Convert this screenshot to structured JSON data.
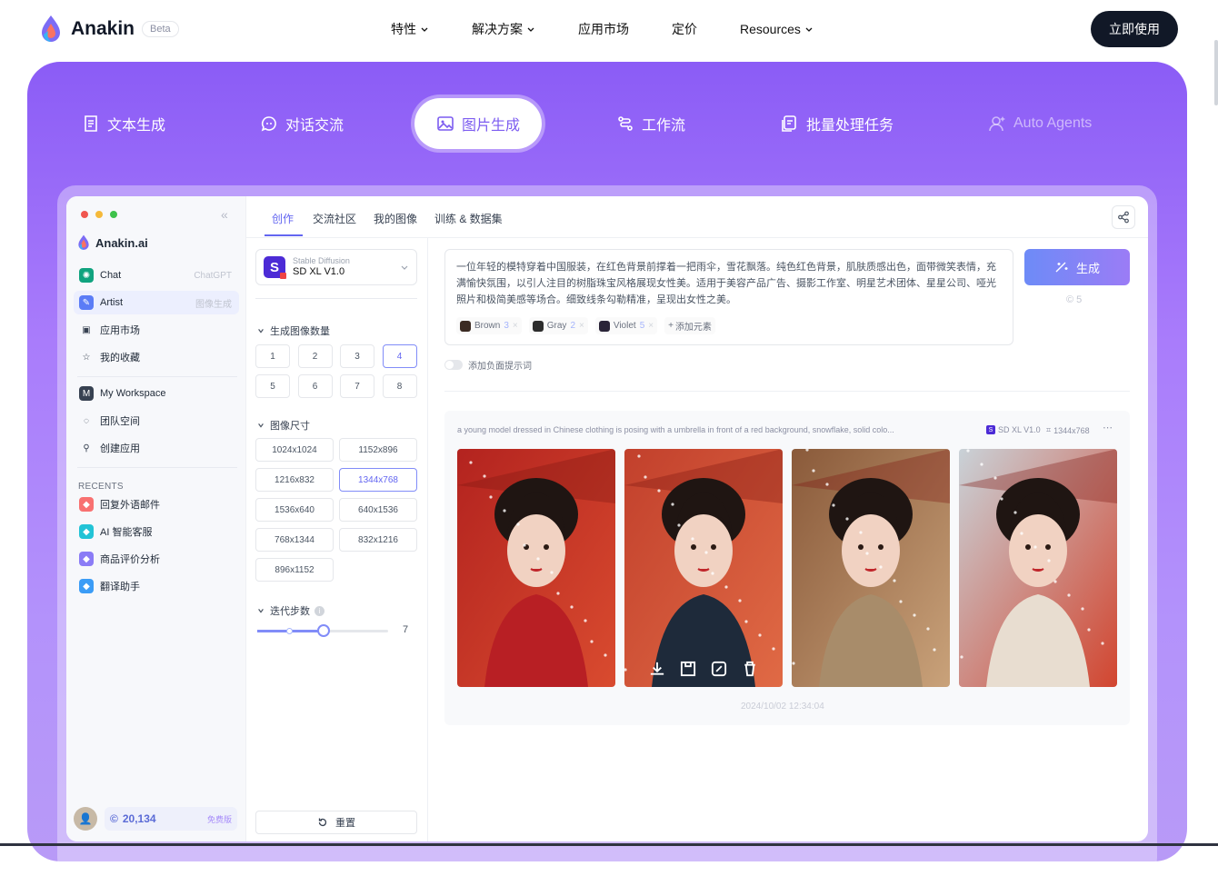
{
  "nav": {
    "logo": "Anakin",
    "beta": "Beta",
    "menu": [
      {
        "label": "特性",
        "dropdown": true
      },
      {
        "label": "解决方案",
        "dropdown": true
      },
      {
        "label": "应用市场",
        "dropdown": false
      },
      {
        "label": "定价",
        "dropdown": false
      },
      {
        "label": "Resources",
        "dropdown": true
      }
    ],
    "cta": "立即使用"
  },
  "feature_tabs": [
    {
      "label": "文本生成",
      "icon": "document-icon"
    },
    {
      "label": "对话交流",
      "icon": "chat-bubble-icon"
    },
    {
      "label": "图片生成",
      "icon": "image-icon",
      "active": true
    },
    {
      "label": "工作流",
      "icon": "workflow-icon"
    },
    {
      "label": "批量处理任务",
      "icon": "batch-icon"
    },
    {
      "label": "Auto Agents",
      "icon": "agent-icon"
    }
  ],
  "app": {
    "brand": "Anakin.ai",
    "sidebar": {
      "items": [
        {
          "label": "Chat",
          "tag": "ChatGPT",
          "icon": "chatgpt-icon"
        },
        {
          "label": "Artist",
          "tag": "图像生成",
          "icon": "artist-icon",
          "selected": true
        },
        {
          "label": "应用市场",
          "tag": "",
          "icon": "store-icon"
        },
        {
          "label": "我的收藏",
          "tag": "",
          "icon": "star-icon"
        }
      ],
      "workspace_items": [
        {
          "label": "My Workspace",
          "icon": "workspace-icon"
        },
        {
          "label": "团队空间",
          "icon": "team-icon"
        },
        {
          "label": "创建应用",
          "icon": "create-app-icon"
        }
      ],
      "recents_title": "RECENTS",
      "recents": [
        {
          "label": "回复外语邮件",
          "color": "#f87171"
        },
        {
          "label": "AI 智能客服",
          "color": "#22c3d6"
        },
        {
          "label": "商品评价分析",
          "color": "#8b7cf6"
        },
        {
          "label": "翻译助手",
          "color": "#3b9cf6"
        }
      ],
      "credits": "20,134",
      "plan": "免费版"
    },
    "top_tabs": [
      "创作",
      "交流社区",
      "我的图像",
      "训练 & 数据集"
    ],
    "model": {
      "provider": "Stable Diffusion",
      "name": "SD XL V1.0"
    },
    "count_title": "生成图像数量",
    "counts": [
      "1",
      "2",
      "3",
      "4",
      "5",
      "6",
      "7",
      "8"
    ],
    "count_selected": "4",
    "size_title": "图像尺寸",
    "sizes": [
      "1024x1024",
      "1152x896",
      "1216x832",
      "1344x768",
      "1536x640",
      "640x1536",
      "768x1344",
      "832x1216",
      "896x1152"
    ],
    "size_selected": "1344x768",
    "steps_title": "迭代步数",
    "steps_value": "7",
    "steps_level_percent": 50,
    "reset": "重置",
    "prompt": "一位年轻的模特穿着中国服装，在红色背景前撑着一把雨伞，雪花飘落。纯色红色背景，肌肤质感出色，面带微笑表情，充满愉快氛围，以引人注目的树脂珠宝风格展现女性美。适用于美容产品广告、摄影工作室、明星艺术团体、星星公司、哑光照片和极简美感等场合。细致线条勾勒精准，呈现出女性之美。",
    "elements": [
      {
        "label": "Brown",
        "num": "3",
        "color": "#3b2a22"
      },
      {
        "label": "Gray",
        "num": "2",
        "color": "#2d2d2d"
      },
      {
        "label": "Violet",
        "num": "5",
        "color": "#2a2438"
      }
    ],
    "add_element": "添加元素",
    "generate": "生成",
    "cost": "5",
    "negative_prompt": "添加负面提示词",
    "result": {
      "caption": "a young model dressed in Chinese clothing is posing with a umbrella in front of a red background, snowflake, solid colo...",
      "model": "SD XL V1.0",
      "size": "1344x768",
      "timestamp": "2024/10/02 12:34:04"
    },
    "image_actions": [
      "download-icon",
      "save-icon",
      "edit-image-icon",
      "delete-icon"
    ]
  },
  "pager": {
    "count": 6,
    "active": 3
  },
  "colors": {
    "accent": "#6d5cf6",
    "hero": "#8b5cf6",
    "cta": "#111827"
  }
}
